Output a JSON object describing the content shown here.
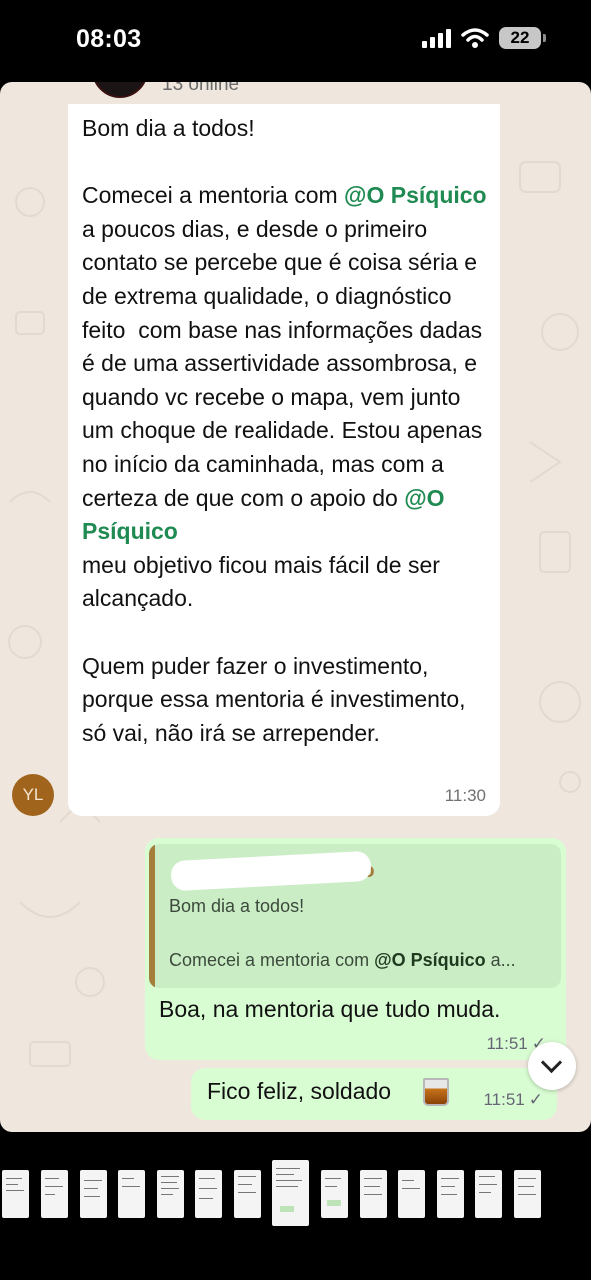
{
  "status_bar": {
    "time": "08:03",
    "battery": "22",
    "icons": [
      "signal-icon",
      "wifi-icon",
      "battery-icon"
    ]
  },
  "header": {
    "online": "13 online"
  },
  "message_in": {
    "greeting": "Bom dia a todos!",
    "p1_a": "Comecei a mentoria com ",
    "mention": "@O Psíquico",
    "p1_b": " a poucos dias, e desde o primeiro contato se percebe que é coisa séria e de extrema qualidade, o diagnóstico feito  com base nas informações dadas é de uma assertividade assombrosa, e quando vc recebe o mapa, vem junto um choque de realidade. Estou apenas no início da caminhada, mas com a certeza de que com o apoio do ",
    "p1_c": "meu objetivo ficou mais fácil de ser alcançado.",
    "p2": "Quem puder fazer o investimento, porque essa mentoria é investimento, só vai, não irá se arrepender.",
    "time": "11:30",
    "avatar_initials": "YL"
  },
  "message_out_1": {
    "quote_name_suffix": "ado",
    "quote_line1": "Bom dia a todos!",
    "quote_line2_a": "Comecei a mentoria com ",
    "quote_line2_mention": "@O Psíquico",
    "quote_line2_b": " a...",
    "text": "Boa, na mentoria que tudo muda.",
    "time": "11:51",
    "check": "✓"
  },
  "message_out_2": {
    "text": "Fico feliz, soldado",
    "emoji": "tumbler-glass",
    "time": "11:51",
    "check": "✓"
  },
  "colors": {
    "chat_bg": "#efe7de",
    "bubble_out": "#d9fdd3",
    "mention": "#1f8a51",
    "quote_name": "#a57d3b",
    "avatar_yl": "#a0641d"
  }
}
